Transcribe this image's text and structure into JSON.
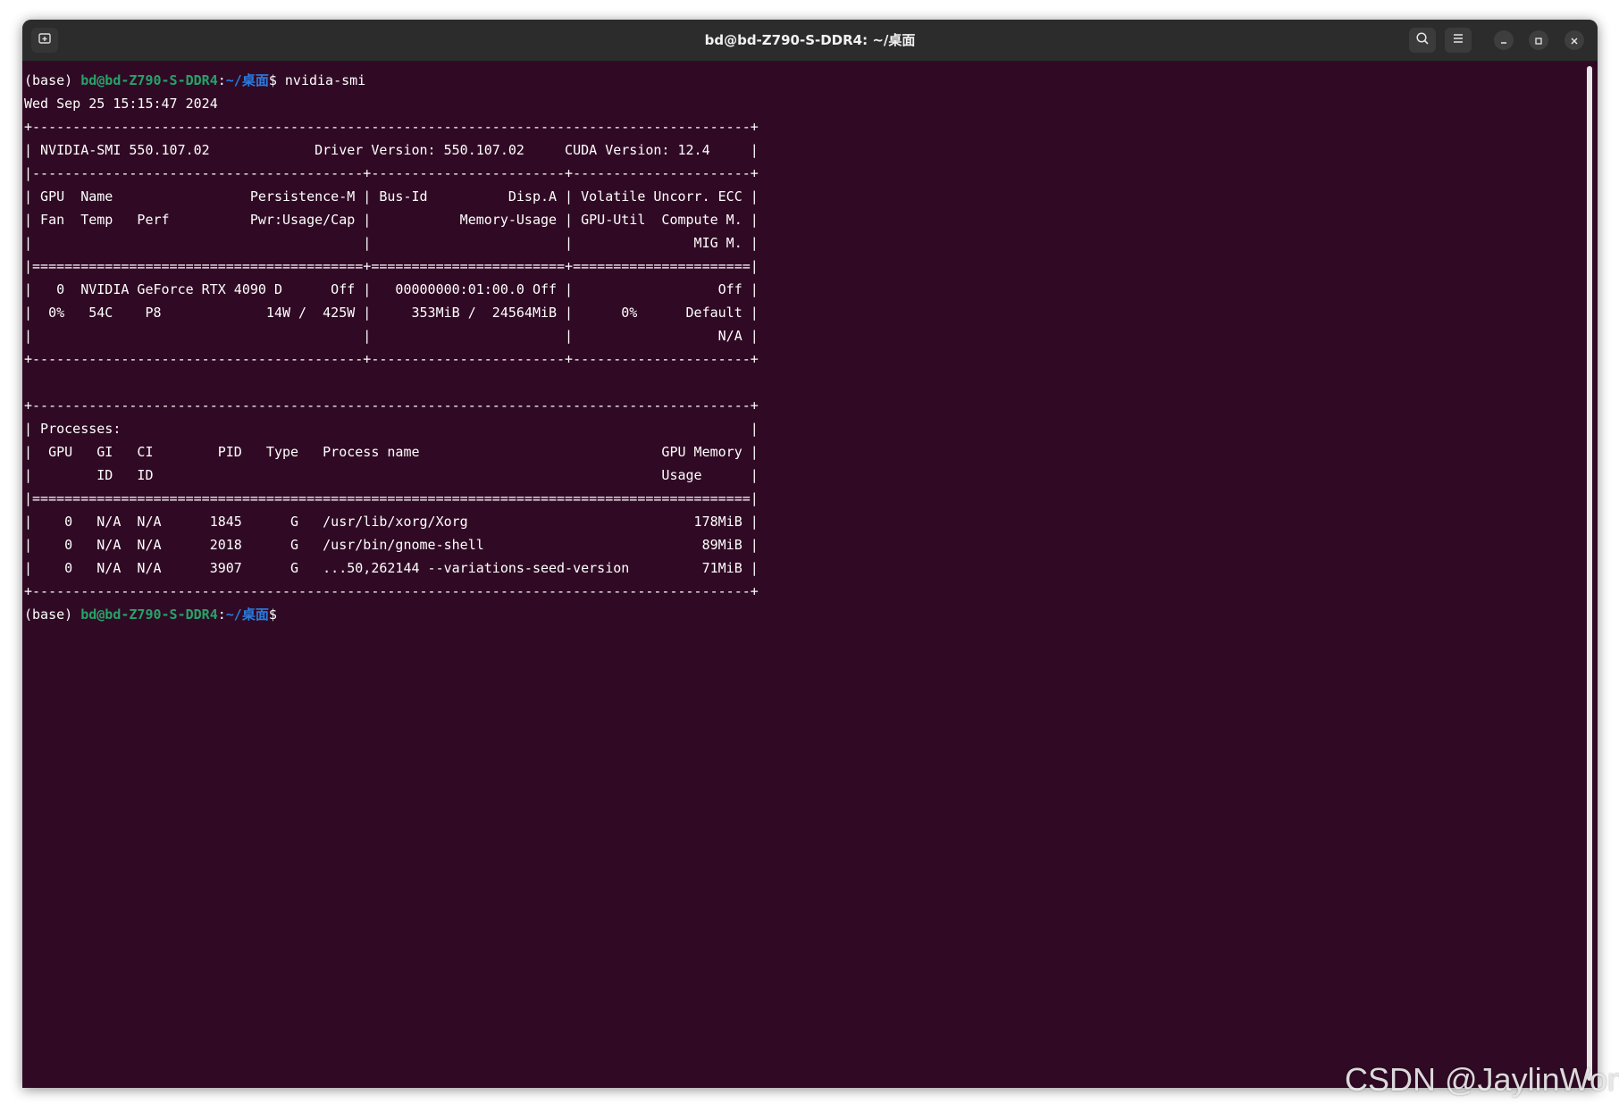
{
  "window": {
    "title": "bd@bd-Z790-S-DDR4: ~/桌面",
    "controls": {
      "new_tab_icon": "new-tab-icon",
      "search_icon": "search-icon",
      "menu_icon": "hamburger-menu-icon",
      "minimize_icon": "minimize-icon",
      "maximize_icon": "maximize-icon",
      "close_icon": "close-icon"
    }
  },
  "terminal": {
    "prompt": {
      "env": "(base) ",
      "user_host": "bd@bd-Z790-S-DDR4",
      "sep": ":",
      "path": "~/桌面",
      "symbol": "$",
      "command": " nvidia-smi"
    },
    "output_lines": [
      "Wed Sep 25 15:15:47 2024",
      "+-----------------------------------------------------------------------------------------+",
      "| NVIDIA-SMI 550.107.02             Driver Version: 550.107.02     CUDA Version: 12.4     |",
      "|-----------------------------------------+------------------------+----------------------+",
      "| GPU  Name                 Persistence-M | Bus-Id          Disp.A | Volatile Uncorr. ECC |",
      "| Fan  Temp   Perf          Pwr:Usage/Cap |           Memory-Usage | GPU-Util  Compute M. |",
      "|                                         |                        |               MIG M. |",
      "|=========================================+========================+======================|",
      "|   0  NVIDIA GeForce RTX 4090 D      Off |   00000000:01:00.0 Off |                  Off |",
      "|  0%   54C    P8             14W /  425W |     353MiB /  24564MiB |      0%      Default |",
      "|                                         |                        |                  N/A |",
      "+-----------------------------------------+------------------------+----------------------+",
      "",
      "+-----------------------------------------------------------------------------------------+",
      "| Processes:                                                                              |",
      "|  GPU   GI   CI        PID   Type   Process name                              GPU Memory |",
      "|        ID   ID                                                               Usage      |",
      "|=========================================================================================|",
      "|    0   N/A  N/A      1845      G   /usr/lib/xorg/Xorg                            178MiB |",
      "|    0   N/A  N/A      2018      G   /usr/bin/gnome-shell                           89MiB |",
      "|    0   N/A  N/A      3907      G   ...50,262144 --variations-seed-version         71MiB |",
      "+-----------------------------------------------------------------------------------------+"
    ],
    "final_prompt": {
      "env": "(base) ",
      "user_host": "bd@bd-Z790-S-DDR4",
      "sep": ":",
      "path": "~/桌面",
      "symbol": "$"
    }
  },
  "watermark": "CSDN @JaylinWong",
  "colors": {
    "terminal_bg": "#300a24",
    "titlebar_bg": "#2c2c2c",
    "prompt_user": "#26a269",
    "prompt_path": "#2a7bde",
    "text": "#ffffff"
  }
}
